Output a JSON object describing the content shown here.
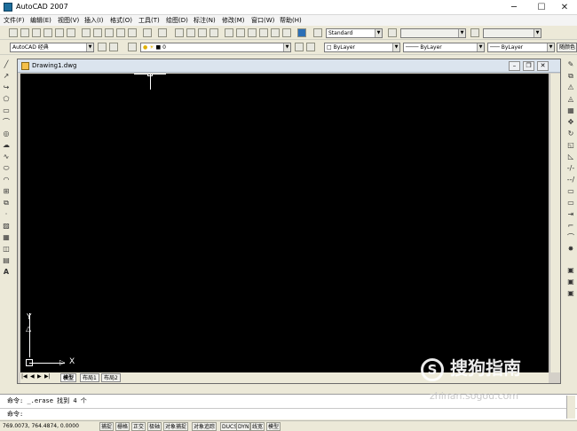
{
  "app": {
    "title": "AutoCAD 2007"
  },
  "menu": [
    "文件(F)",
    "编辑(E)",
    "视图(V)",
    "插入(I)",
    "格式(O)",
    "工具(T)",
    "绘图(D)",
    "标注(N)",
    "修改(M)",
    "窗口(W)",
    "帮助(H)"
  ],
  "toolbar": {
    "text_style": "Standard",
    "workspace": "AutoCAD 经典",
    "layer": "0",
    "color": "ByLayer",
    "linetype": "ByLayer",
    "lineweight": "ByLayer",
    "plot_style": "随颜色"
  },
  "document": {
    "title": "Drawing1.dwg",
    "axis_y": "Y",
    "axis_x": "X"
  },
  "tabs": [
    "模型",
    "布局1",
    "布局2"
  ],
  "command": {
    "line1_label": "命令:",
    "line1_text": "_.erase 找到 4 个",
    "line2_label": "命令:"
  },
  "status": {
    "coords": "769.0073,  764.4874, 0.0000",
    "buttons": [
      "捕捉",
      "栅格",
      "正交",
      "极轴",
      "对象捕捉",
      "对象追踪",
      "DUCS",
      "DYN",
      "线宽",
      "模型"
    ]
  },
  "watermark": {
    "main": "搜狗指南",
    "sub": "zhinan.sogou.com"
  },
  "colors": {
    "canvas": "#000000",
    "chrome": "#ece9d8",
    "accent": "#1e6e9c"
  },
  "icons": {
    "left": [
      "line-icon",
      "construction-line-icon",
      "polyline-icon",
      "polygon-icon",
      "rectangle-icon",
      "arc-icon",
      "circle-icon",
      "revision-cloud-icon",
      "spline-icon",
      "ellipse-icon",
      "ellipse-arc-icon",
      "insert-block-icon",
      "make-block-icon",
      "point-icon",
      "hatch-icon",
      "gradient-icon",
      "region-icon",
      "table-icon",
      "text-icon"
    ],
    "right": [
      "erase-icon",
      "copy-icon",
      "mirror-icon",
      "offset-icon",
      "array-icon",
      "move-icon",
      "rotate-icon",
      "scale-icon",
      "stretch-icon",
      "trim-icon",
      "extend-icon",
      "break-at-point-icon",
      "break-icon",
      "join-icon",
      "chamfer-icon",
      "fillet-icon",
      "explode-icon"
    ]
  }
}
